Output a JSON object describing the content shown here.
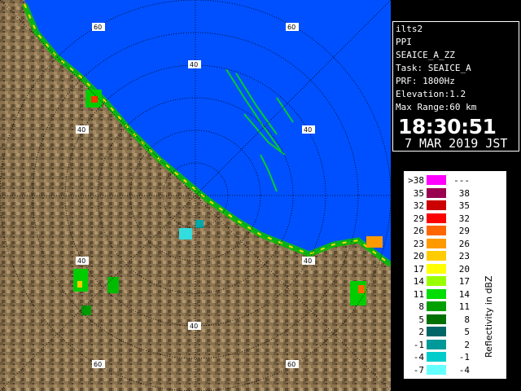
{
  "info": {
    "station": "ilts2",
    "mode": "PPI",
    "product": "SEAICE_A_ZZ",
    "task": "Task: SEAICE_A",
    "prf": "PRF: 1800Hz",
    "elevation": "Elevation:1.2",
    "max_range": "Max Range:60 km",
    "time": "18:30:51",
    "date": "7 MAR 2019 JST"
  },
  "legend": {
    "title": "Reflectivity in dBZ",
    "rows": [
      {
        "lo": ">38",
        "hi": "---",
        "color": "#ff00ff"
      },
      {
        "lo": "35",
        "hi": "38",
        "color": "#9a0050"
      },
      {
        "lo": "32",
        "hi": "35",
        "color": "#cc0000"
      },
      {
        "lo": "29",
        "hi": "32",
        "color": "#ff0000"
      },
      {
        "lo": "26",
        "hi": "29",
        "color": "#ff6600"
      },
      {
        "lo": "23",
        "hi": "26",
        "color": "#ff9900"
      },
      {
        "lo": "20",
        "hi": "23",
        "color": "#ffcc00"
      },
      {
        "lo": "17",
        "hi": "20",
        "color": "#ffff00"
      },
      {
        "lo": "14",
        "hi": "17",
        "color": "#99ff00"
      },
      {
        "lo": "11",
        "hi": "14",
        "color": "#00dd00"
      },
      {
        "lo": "8",
        "hi": "11",
        "color": "#00a000"
      },
      {
        "lo": "5",
        "hi": "8",
        "color": "#007000"
      },
      {
        "lo": "2",
        "hi": "5",
        "color": "#006666"
      },
      {
        "lo": "-1",
        "hi": "2",
        "color": "#009999"
      },
      {
        "lo": "-4",
        "hi": "-1",
        "color": "#00cccc"
      },
      {
        "lo": "-7",
        "hi": "-4",
        "color": "#66ffff"
      }
    ]
  },
  "map": {
    "range_ring_labels": [
      "40",
      "60"
    ],
    "sea_color": "#0050ff",
    "land_color": "#8a7452"
  }
}
